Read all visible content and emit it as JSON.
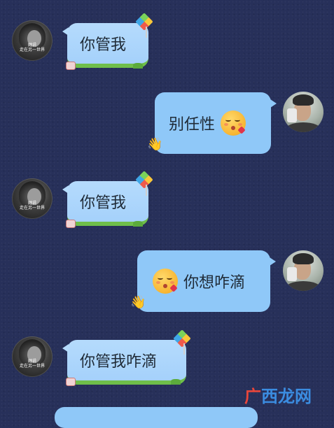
{
  "messages": [
    {
      "side": "left",
      "text": "你管我"
    },
    {
      "side": "right",
      "text": "别任性",
      "emoji": "face-blowing-kiss"
    },
    {
      "side": "left",
      "text": "你管我"
    },
    {
      "side": "right",
      "text": "你想咋滴",
      "emoji": "face-blowing-kiss"
    },
    {
      "side": "left",
      "text": "你管我咋滴"
    }
  ],
  "contact_avatar": {
    "caption_line1": "她说",
    "caption_line2": "走在另一世界"
  },
  "watermark": {
    "part1": "广",
    "part2": "西",
    "part3": "龙网"
  },
  "colors": {
    "background": "#27305a",
    "left_bubble": "#b5dbfc",
    "right_bubble": "#8fc8f8",
    "watermark_red": "#e8463a",
    "watermark_blue": "#3b8ce0"
  }
}
